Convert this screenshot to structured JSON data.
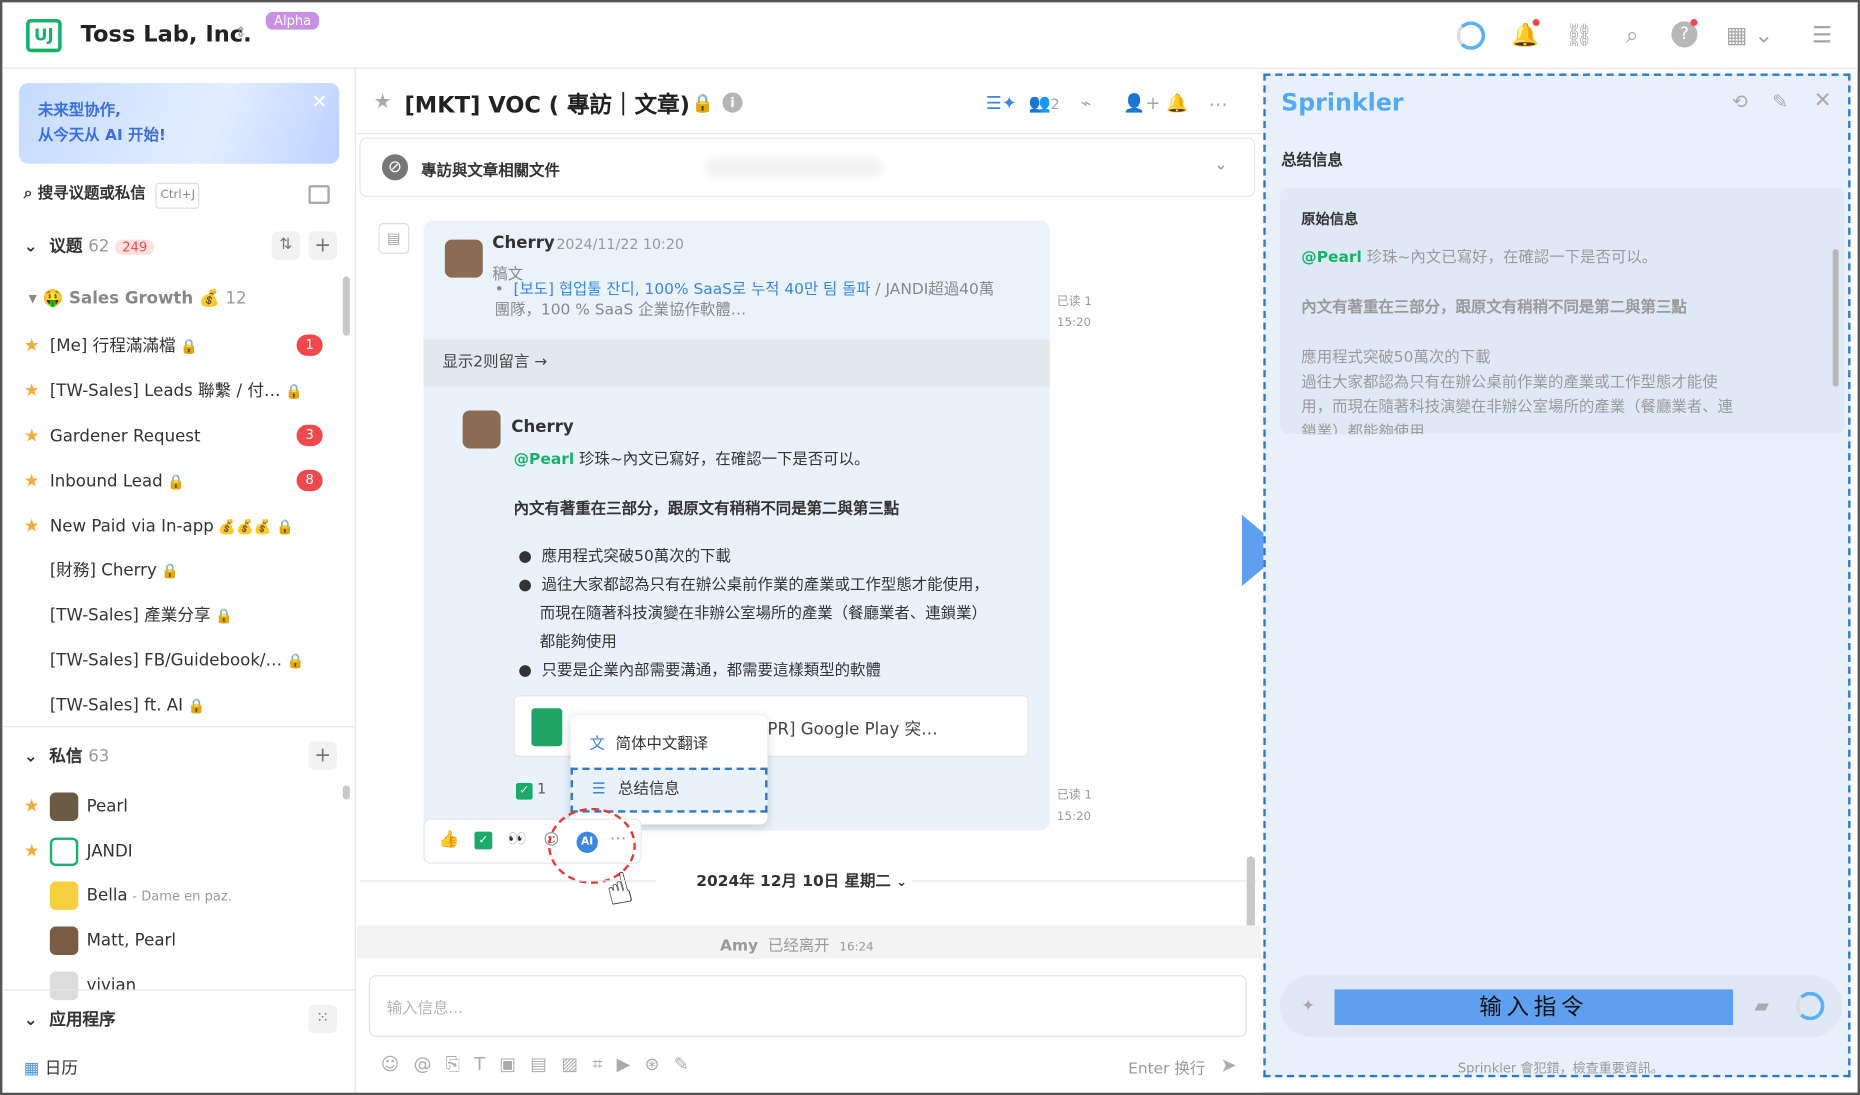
{
  "header": {
    "org_name": "Toss Lab, Inc.",
    "alpha_badge": "Alpha",
    "logo": "jandi-logo-icon"
  },
  "sidebar": {
    "banner_line1": "未来型协作,",
    "banner_line2": "从今天从 AI 开始!",
    "search_placeholder": "搜寻议题或私信",
    "search_shortcut": "Ctrl+J",
    "topics": {
      "label": "议题",
      "count": "62",
      "unread": "249"
    },
    "group": {
      "label": "Sales Growth",
      "count": "12"
    },
    "topic_items": [
      {
        "label": "[Me] 行程滿滿檔",
        "badge": "1"
      },
      {
        "label": "[TW-Sales] Leads 聯繫 / 付…",
        "badge": ""
      },
      {
        "label": "Gardener Request",
        "badge": "3"
      },
      {
        "label": "Inbound Lead",
        "badge": "8"
      },
      {
        "label": "New Paid via In-app",
        "badge": ""
      },
      {
        "label": "[財務] Cherry",
        "badge": ""
      },
      {
        "label": "[TW-Sales] 產業分享",
        "badge": ""
      },
      {
        "label": "[TW-Sales] FB/Guidebook/…",
        "badge": ""
      },
      {
        "label": "[TW-Sales] ft. AI",
        "badge": ""
      }
    ],
    "dms": {
      "label": "私信",
      "count": "63"
    },
    "dm_items": [
      {
        "label": "Pearl",
        "sub": ""
      },
      {
        "label": "JANDI",
        "sub": ""
      },
      {
        "label": "Bella",
        "sub": "- Dame en paz."
      },
      {
        "label": "Matt, Pearl",
        "sub": ""
      },
      {
        "label": "vivian",
        "sub": ""
      }
    ],
    "apps": {
      "label": "应用程序"
    },
    "calendar": "日历"
  },
  "channel": {
    "title": "[MKT] VOC ( 專訪｜文章)",
    "member_count": "2",
    "announcement": "專訪與文章相關文件"
  },
  "message": {
    "author": "Cherry",
    "time": "2024/11/22 10:20",
    "kind": "稿文",
    "link_text": "[보도] 협업툴 잔디, 100% SaaS로 누적 40만 팀 돌파",
    "link_rest": " / JANDI超過40萬",
    "link_line2": "團隊，100 % SaaS 企業協作軟體…",
    "show_replies": "显示2则留言 →",
    "read1": "已读 1",
    "read1_time": "15:20",
    "reply_author": "Cherry",
    "mention": "@Pearl",
    "reply_line1": " 珍珠~內文已寫好，在確認一下是否可以。",
    "reply_bold": "內文有著重在三部分，跟原文有稍稍不同是第二與第三點",
    "bullets": [
      "應用程式突破50萬次的下載",
      "過往大家都認為只有在辦公桌前作業的產業或工作型態才能使用，",
      "而現在隨著科技演變在非辦公室場所的產業（餐廳業者、連鎖業）",
      "都能夠使用",
      "只要是企業內部需要溝通，都需要這樣類型的軟體"
    ],
    "file_name": "PR] Google Play 突…",
    "check_count": "1",
    "read2": "已读 1",
    "read2_time": "15:20"
  },
  "popup": {
    "translate": "简体中文翻译",
    "summarize": "总结信息"
  },
  "date_divider": "2024年 12月 10日 星期二",
  "leave": {
    "name": "Amy",
    "text": "已经离开",
    "time": "16:24"
  },
  "composer": {
    "placeholder": "输入信息...",
    "enter_hint": "Enter 换行"
  },
  "sprinkler": {
    "title": "Sprinkler",
    "section": "总结信息",
    "orig_label": "原始信息",
    "mention": "@Pearl",
    "line1": " 珍珠~內文已寫好，在確認一下是否可以。",
    "bold": "內文有著重在三部分，跟原文有稍稍不同是第二與第三點",
    "l1": "應用程式突破50萬次的下載",
    "l2": "過往大家都認為只有在辦公桌前作業的產業或工作型態才能使",
    "l3": "用，而現在隨著科技演變在非辦公室場所的產業（餐廳業者、連",
    "l4": "鎖業）都能夠使用",
    "command_label": "输入指令",
    "footer": "Sprinkler 會犯錯，檢查重要資訊。"
  },
  "colors": {
    "accent": "#16b26a",
    "blue": "#56aaf0",
    "badge_red": "#f0484c",
    "highlight_border": "#2f79c9"
  }
}
